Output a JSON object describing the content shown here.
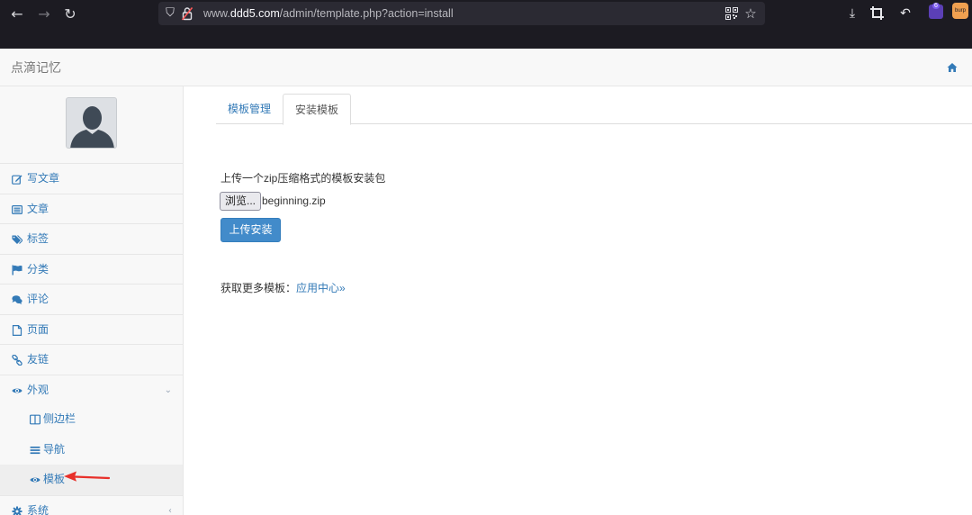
{
  "browser": {
    "url_prefix": "www.",
    "url_domain": "ddd5.com",
    "url_path": "/admin/template.php?action=install",
    "extension_badge": "6",
    "burp_label": "burp"
  },
  "header": {
    "brand": "点滴记忆"
  },
  "sidebar": {
    "items": [
      {
        "label": "写文章",
        "icon": "edit-icon"
      },
      {
        "label": "文章",
        "icon": "list-icon"
      },
      {
        "label": "标签",
        "icon": "tags-icon"
      },
      {
        "label": "分类",
        "icon": "flag-icon"
      },
      {
        "label": "评论",
        "icon": "comments-icon"
      },
      {
        "label": "页面",
        "icon": "file-icon"
      },
      {
        "label": "友链",
        "icon": "link-icon"
      },
      {
        "label": "外观",
        "icon": "eye-icon",
        "expanded": true
      },
      {
        "label": "侧边栏",
        "icon": "columns-icon"
      },
      {
        "label": "导航",
        "icon": "bars-icon"
      },
      {
        "label": "模板",
        "icon": "eye-icon",
        "active": true
      },
      {
        "label": "系统",
        "icon": "gear-icon"
      }
    ]
  },
  "main": {
    "tabs": [
      {
        "label": "模板管理",
        "active": false
      },
      {
        "label": "安装模板",
        "active": true
      }
    ],
    "upload_label": "上传一个zip压缩格式的模板安装包",
    "browse_label": "浏览...",
    "file_name": "beginning.zip",
    "install_label": "上传安装",
    "more_label": "获取更多模板：",
    "more_link": "应用中心»"
  },
  "colors": {
    "link": "#337ab7",
    "primary_button": "#428bca",
    "chrome_bg": "#1c1b22",
    "annotation_arrow": "#e8302a"
  }
}
